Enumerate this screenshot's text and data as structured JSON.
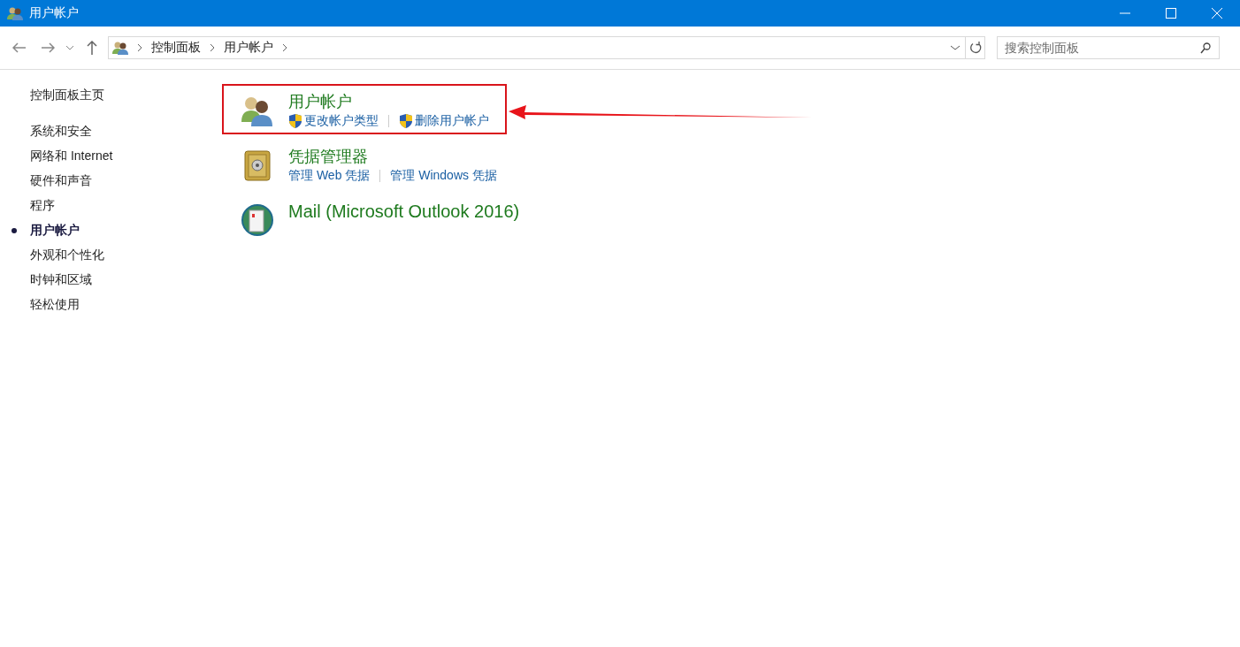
{
  "window": {
    "title": "用户帐户"
  },
  "address": {
    "crumbs": [
      "控制面板",
      "用户帐户"
    ]
  },
  "search": {
    "placeholder": "搜索控制面板"
  },
  "sidebar": {
    "home": "控制面板主页",
    "items": [
      {
        "label": "系统和安全",
        "selected": false
      },
      {
        "label": "网络和 Internet",
        "selected": false
      },
      {
        "label": "硬件和声音",
        "selected": false
      },
      {
        "label": "程序",
        "selected": false
      },
      {
        "label": "用户帐户",
        "selected": true
      },
      {
        "label": "外观和个性化",
        "selected": false
      },
      {
        "label": "时钟和区域",
        "selected": false
      },
      {
        "label": "轻松使用",
        "selected": false
      }
    ]
  },
  "categories": [
    {
      "kind": "users",
      "title": "用户帐户",
      "highlighted": true,
      "tasks": [
        {
          "text": "更改帐户类型",
          "shield": true
        },
        {
          "text": "删除用户帐户",
          "shield": true
        }
      ]
    },
    {
      "kind": "vault",
      "title": "凭据管理器",
      "highlighted": false,
      "tasks": [
        {
          "text": "管理 Web 凭据",
          "shield": false
        },
        {
          "text": "管理 Windows 凭据",
          "shield": false
        }
      ]
    },
    {
      "kind": "mail",
      "title": "Mail (Microsoft Outlook 2016)",
      "highlighted": false
    }
  ]
}
